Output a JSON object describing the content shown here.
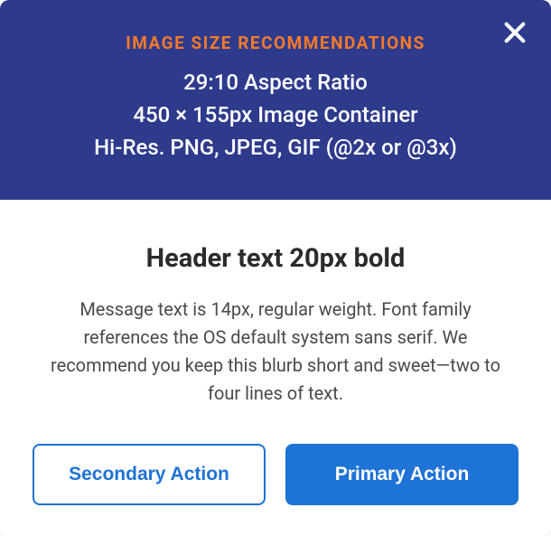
{
  "banner": {
    "title": "IMAGE SIZE RECOMMENDATIONS",
    "line1": "29:10 Aspect Ratio",
    "line2": "450 × 155px Image Container",
    "line3": "Hi-Res. PNG, JPEG, GIF (@2x or @3x)"
  },
  "header": "Header text 20px bold",
  "message": "Message text is 14px, regular weight. Font family references the OS default system sans serif. We recommend you keep this blurb short and sweet—two to four lines of text.",
  "actions": {
    "secondary": "Secondary Action",
    "primary": "Primary Action"
  },
  "colors": {
    "bannerBg": "#2E3A8C",
    "accentOrange": "#F47A2B",
    "primaryBlue": "#1E73D6"
  }
}
